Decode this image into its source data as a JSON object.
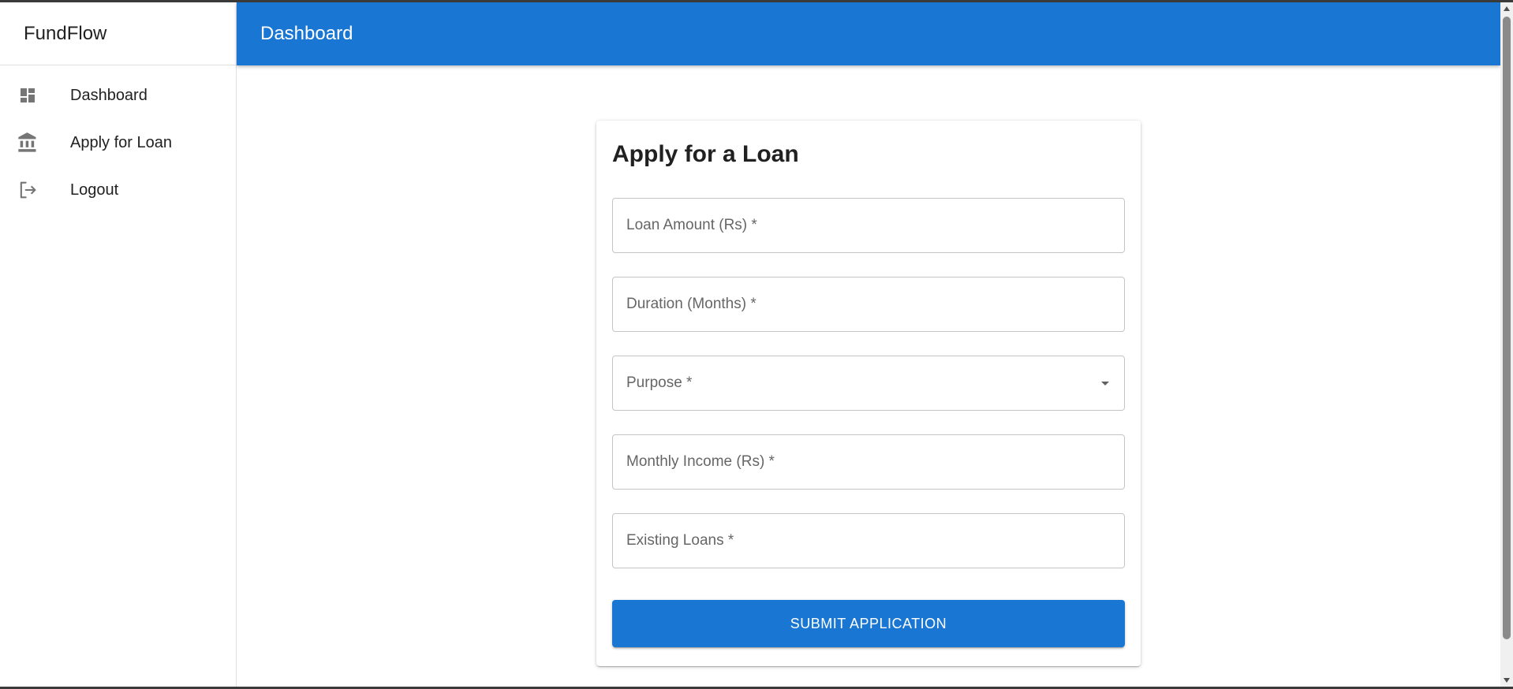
{
  "sidebar": {
    "brand": "FundFlow",
    "items": [
      {
        "label": "Dashboard",
        "icon": "dashboard-icon"
      },
      {
        "label": "Apply for Loan",
        "icon": "bank-icon"
      },
      {
        "label": "Logout",
        "icon": "logout-icon"
      }
    ]
  },
  "appbar": {
    "title": "Dashboard"
  },
  "form": {
    "title": "Apply for a Loan",
    "fields": {
      "loan_amount": {
        "label": "Loan Amount (Rs) *",
        "value": ""
      },
      "duration": {
        "label": "Duration (Months) *",
        "value": ""
      },
      "purpose": {
        "label": "Purpose *",
        "value": ""
      },
      "monthly_income": {
        "label": "Monthly Income (Rs) *",
        "value": ""
      },
      "existing_loans": {
        "label": "Existing Loans *",
        "value": ""
      }
    },
    "submit_label": "SUBMIT APPLICATION"
  },
  "colors": {
    "primary": "#1976d2",
    "icon_grey": "#757575"
  }
}
